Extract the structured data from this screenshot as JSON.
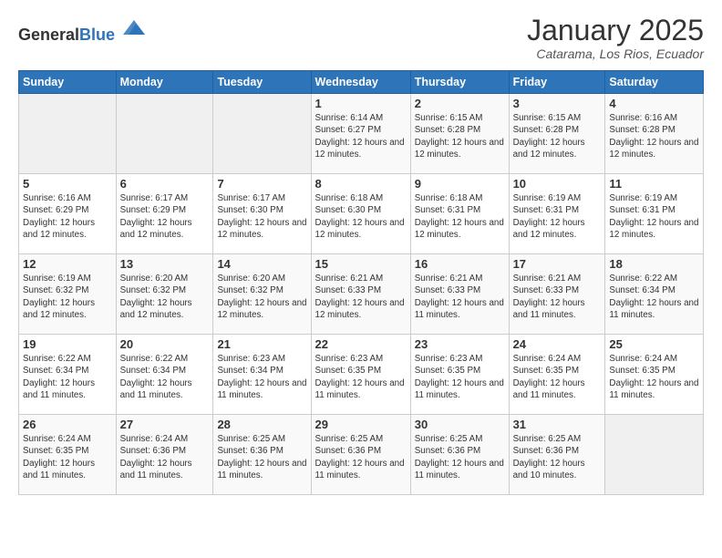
{
  "header": {
    "logo_general": "General",
    "logo_blue": "Blue",
    "month_title": "January 2025",
    "subtitle": "Catarama, Los Rios, Ecuador"
  },
  "days_of_week": [
    "Sunday",
    "Monday",
    "Tuesday",
    "Wednesday",
    "Thursday",
    "Friday",
    "Saturday"
  ],
  "weeks": [
    [
      {
        "day": "",
        "info": ""
      },
      {
        "day": "",
        "info": ""
      },
      {
        "day": "",
        "info": ""
      },
      {
        "day": "1",
        "info": "Sunrise: 6:14 AM\nSunset: 6:27 PM\nDaylight: 12 hours and 12 minutes."
      },
      {
        "day": "2",
        "info": "Sunrise: 6:15 AM\nSunset: 6:28 PM\nDaylight: 12 hours and 12 minutes."
      },
      {
        "day": "3",
        "info": "Sunrise: 6:15 AM\nSunset: 6:28 PM\nDaylight: 12 hours and 12 minutes."
      },
      {
        "day": "4",
        "info": "Sunrise: 6:16 AM\nSunset: 6:28 PM\nDaylight: 12 hours and 12 minutes."
      }
    ],
    [
      {
        "day": "5",
        "info": "Sunrise: 6:16 AM\nSunset: 6:29 PM\nDaylight: 12 hours and 12 minutes."
      },
      {
        "day": "6",
        "info": "Sunrise: 6:17 AM\nSunset: 6:29 PM\nDaylight: 12 hours and 12 minutes."
      },
      {
        "day": "7",
        "info": "Sunrise: 6:17 AM\nSunset: 6:30 PM\nDaylight: 12 hours and 12 minutes."
      },
      {
        "day": "8",
        "info": "Sunrise: 6:18 AM\nSunset: 6:30 PM\nDaylight: 12 hours and 12 minutes."
      },
      {
        "day": "9",
        "info": "Sunrise: 6:18 AM\nSunset: 6:31 PM\nDaylight: 12 hours and 12 minutes."
      },
      {
        "day": "10",
        "info": "Sunrise: 6:19 AM\nSunset: 6:31 PM\nDaylight: 12 hours and 12 minutes."
      },
      {
        "day": "11",
        "info": "Sunrise: 6:19 AM\nSunset: 6:31 PM\nDaylight: 12 hours and 12 minutes."
      }
    ],
    [
      {
        "day": "12",
        "info": "Sunrise: 6:19 AM\nSunset: 6:32 PM\nDaylight: 12 hours and 12 minutes."
      },
      {
        "day": "13",
        "info": "Sunrise: 6:20 AM\nSunset: 6:32 PM\nDaylight: 12 hours and 12 minutes."
      },
      {
        "day": "14",
        "info": "Sunrise: 6:20 AM\nSunset: 6:32 PM\nDaylight: 12 hours and 12 minutes."
      },
      {
        "day": "15",
        "info": "Sunrise: 6:21 AM\nSunset: 6:33 PM\nDaylight: 12 hours and 12 minutes."
      },
      {
        "day": "16",
        "info": "Sunrise: 6:21 AM\nSunset: 6:33 PM\nDaylight: 12 hours and 11 minutes."
      },
      {
        "day": "17",
        "info": "Sunrise: 6:21 AM\nSunset: 6:33 PM\nDaylight: 12 hours and 11 minutes."
      },
      {
        "day": "18",
        "info": "Sunrise: 6:22 AM\nSunset: 6:34 PM\nDaylight: 12 hours and 11 minutes."
      }
    ],
    [
      {
        "day": "19",
        "info": "Sunrise: 6:22 AM\nSunset: 6:34 PM\nDaylight: 12 hours and 11 minutes."
      },
      {
        "day": "20",
        "info": "Sunrise: 6:22 AM\nSunset: 6:34 PM\nDaylight: 12 hours and 11 minutes."
      },
      {
        "day": "21",
        "info": "Sunrise: 6:23 AM\nSunset: 6:34 PM\nDaylight: 12 hours and 11 minutes."
      },
      {
        "day": "22",
        "info": "Sunrise: 6:23 AM\nSunset: 6:35 PM\nDaylight: 12 hours and 11 minutes."
      },
      {
        "day": "23",
        "info": "Sunrise: 6:23 AM\nSunset: 6:35 PM\nDaylight: 12 hours and 11 minutes."
      },
      {
        "day": "24",
        "info": "Sunrise: 6:24 AM\nSunset: 6:35 PM\nDaylight: 12 hours and 11 minutes."
      },
      {
        "day": "25",
        "info": "Sunrise: 6:24 AM\nSunset: 6:35 PM\nDaylight: 12 hours and 11 minutes."
      }
    ],
    [
      {
        "day": "26",
        "info": "Sunrise: 6:24 AM\nSunset: 6:35 PM\nDaylight: 12 hours and 11 minutes."
      },
      {
        "day": "27",
        "info": "Sunrise: 6:24 AM\nSunset: 6:36 PM\nDaylight: 12 hours and 11 minutes."
      },
      {
        "day": "28",
        "info": "Sunrise: 6:25 AM\nSunset: 6:36 PM\nDaylight: 12 hours and 11 minutes."
      },
      {
        "day": "29",
        "info": "Sunrise: 6:25 AM\nSunset: 6:36 PM\nDaylight: 12 hours and 11 minutes."
      },
      {
        "day": "30",
        "info": "Sunrise: 6:25 AM\nSunset: 6:36 PM\nDaylight: 12 hours and 11 minutes."
      },
      {
        "day": "31",
        "info": "Sunrise: 6:25 AM\nSunset: 6:36 PM\nDaylight: 12 hours and 10 minutes."
      },
      {
        "day": "",
        "info": ""
      }
    ]
  ]
}
